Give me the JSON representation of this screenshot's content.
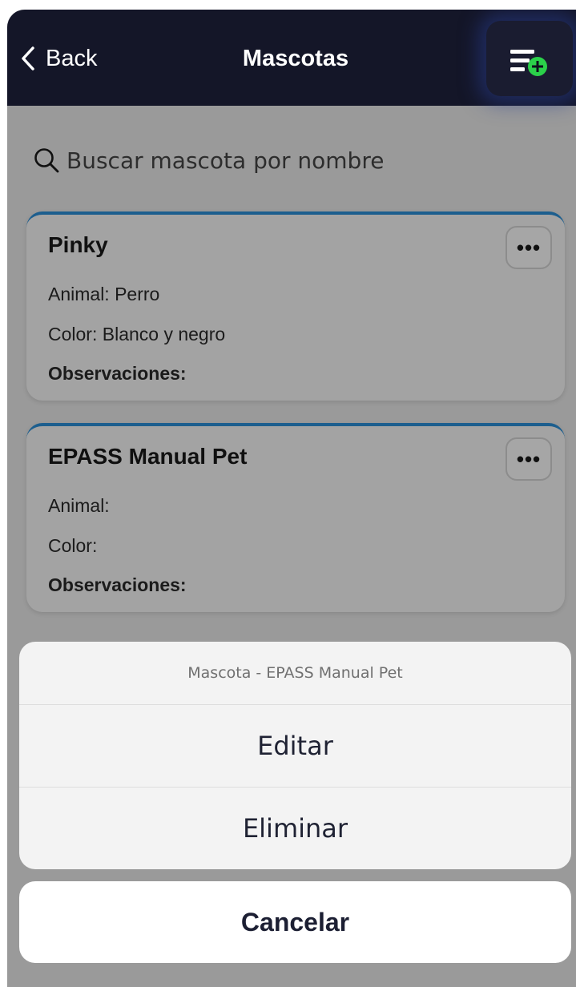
{
  "header": {
    "back_label": "Back",
    "title": "Mascotas",
    "add_icon": "list-add-icon"
  },
  "search": {
    "placeholder": "Buscar mascota por nombre",
    "icon": "search-icon"
  },
  "pets": [
    {
      "name": "Pinky",
      "animal": "Animal: Perro",
      "color": "Color: Blanco y negro",
      "observations": "Observaciones:",
      "menu_label": "•••"
    },
    {
      "name": "EPASS Manual Pet",
      "animal": "Animal:",
      "color": "Color:",
      "observations": "Observaciones:",
      "menu_label": "•••"
    }
  ],
  "action_sheet": {
    "title": "Mascota - EPASS Manual Pet",
    "actions": [
      "Editar",
      "Eliminar"
    ],
    "cancel": "Cancelar"
  },
  "colors": {
    "header_bg": "#141628",
    "card_accent": "#1c5e8e",
    "add_badge": "#2bd14a"
  }
}
